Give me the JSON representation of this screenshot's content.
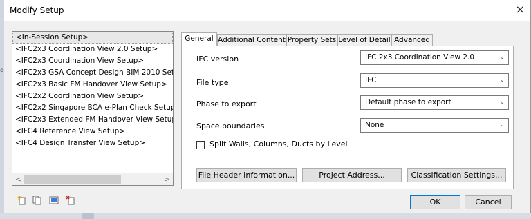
{
  "window": {
    "title": "Modify Setup"
  },
  "setups": [
    "<In-Session Setup>",
    "<IFC2x3 Coordination View 2.0 Setup>",
    "<IFC2x3 Coordination View Setup>",
    "<IFC2x3 GSA Concept Design BIM 2010 Setup>",
    "<IFC2x3 Basic FM Handover View Setup>",
    "<IFC2x2 Coordination View Setup>",
    "<IFC2x2 Singapore BCA e-Plan Check Setup>",
    "<IFC2x3 Extended FM Handover View Setup>",
    "<IFC4 Reference View Setup>",
    "<IFC4 Design Transfer View Setup>"
  ],
  "tabs": [
    "General",
    "Additional Content",
    "Property Sets",
    "Level of Detail",
    "Advanced"
  ],
  "general": {
    "ifc_version_label": "IFC version",
    "ifc_version_value": "IFC 2x3 Coordination View 2.0",
    "file_type_label": "File type",
    "file_type_value": "IFC",
    "phase_label": "Phase to export",
    "phase_value": "Default phase to export",
    "space_label": "Space boundaries",
    "space_value": "None",
    "split_label": "Split Walls, Columns, Ducts by Level"
  },
  "buttons": {
    "file_header": "File Header Information...",
    "project_address": "Project Address...",
    "classification": "Classification Settings...",
    "ok": "OK",
    "cancel": "Cancel"
  },
  "icons": {
    "close": "×",
    "scroll_left": "<",
    "scroll_right": ">",
    "dropdown": "⌄",
    "toolbar": [
      "new-setup-icon",
      "duplicate-setup-icon",
      "rename-setup-icon",
      "delete-setup-icon"
    ]
  },
  "colors": {
    "accent": "#0078d7",
    "selected": "#e8e8e8"
  }
}
